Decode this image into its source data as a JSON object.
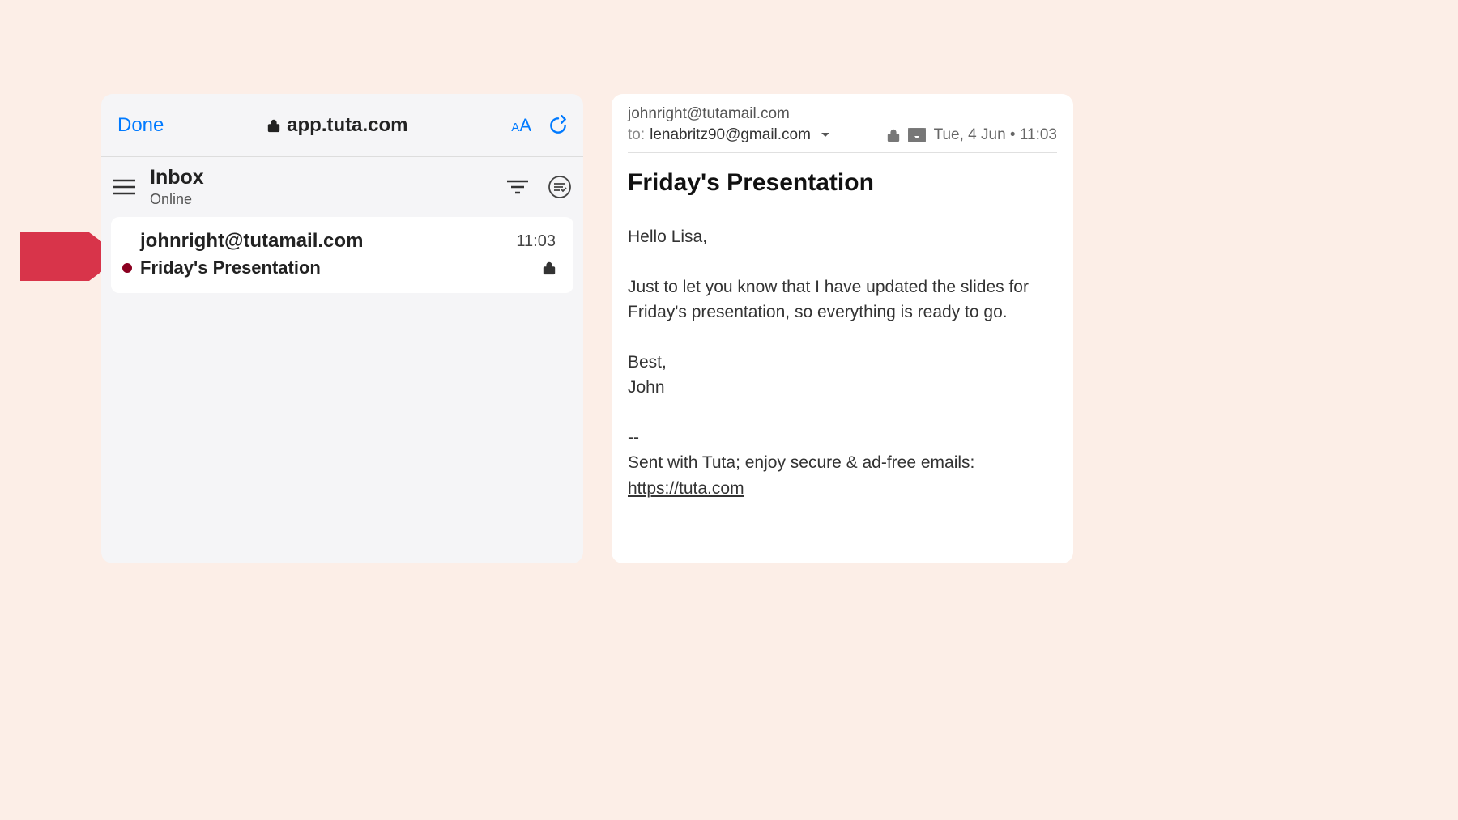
{
  "browser": {
    "done_label": "Done",
    "address": "app.tuta.com"
  },
  "inbox": {
    "title": "Inbox",
    "status": "Online"
  },
  "email_item": {
    "sender": "johnright@tutamail.com",
    "time": "11:03",
    "subject": "Friday's Presentation"
  },
  "message": {
    "from": "johnright@tutamail.com",
    "to_label": "to:",
    "to_email": "lenabritz90@gmail.com",
    "date": "Tue, 4 Jun • 11:03",
    "title": "Friday's Presentation",
    "greeting": "Hello Lisa,",
    "body": "Just to let you know that I have updated the slides for Friday's presentation, so everything is ready to go.",
    "closing1": "Best,",
    "closing2": "John",
    "sig_sep": "--",
    "signature": "Sent with Tuta; enjoy secure & ad-free emails:",
    "link": "https://tuta.com"
  }
}
